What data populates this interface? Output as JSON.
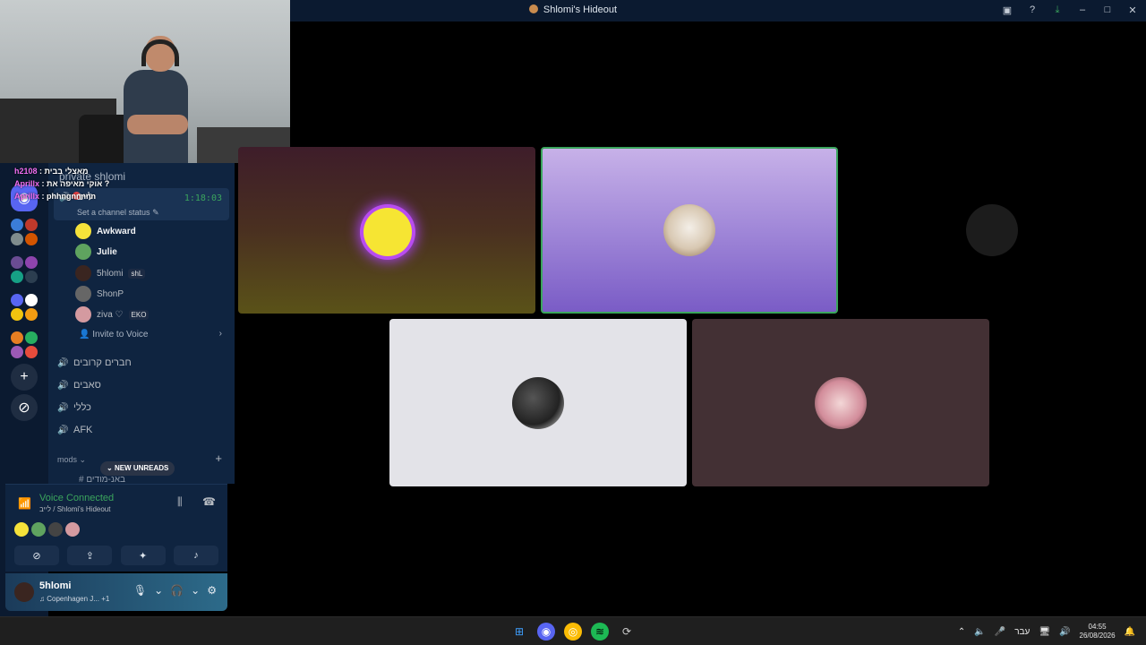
{
  "window": {
    "title": "Shlomi's Hideout"
  },
  "chat_overlay": [
    {
      "name": "h2108",
      "message": "מאצלי בבית"
    },
    {
      "name": "Aprillx",
      "message": "אוקי מאיפה את ?"
    },
    {
      "name": "Aprillx",
      "message": "phhngnnnnn"
    }
  ],
  "channels": {
    "header": "private shlomi",
    "active_voice": {
      "name": "לייב",
      "timer": "1:18:03",
      "status": "Set a channel status",
      "members": [
        {
          "name": "Awkward",
          "tag": ""
        },
        {
          "name": "Julie",
          "tag": ""
        },
        {
          "name": "5hlomi",
          "tag": "shL"
        },
        {
          "name": "ShonP",
          "tag": ""
        },
        {
          "name": "ziva ♡",
          "tag": "EKO"
        }
      ],
      "invite_label": "Invite to Voice"
    },
    "voice_channels": [
      "חברים קרובים",
      "סאבים",
      "כללי",
      "AFK"
    ],
    "category": "mods",
    "new_unreads": "NEW UNREADS",
    "hash_channel": "באנ-מודים"
  },
  "voice_connected": {
    "title": "Voice Connected",
    "subtitle": "לייב / Shlomi's Hideout"
  },
  "user": {
    "name": "5hlomi",
    "activity": "Copenhagen J...",
    "extra": "+1"
  },
  "taskbar": {
    "language": "עבר",
    "time": "04:55",
    "date": "26/08/2026"
  },
  "colors": {
    "accent": "#5865f2",
    "voice_green": "#3ba55d",
    "live_red": "#ed4245"
  }
}
